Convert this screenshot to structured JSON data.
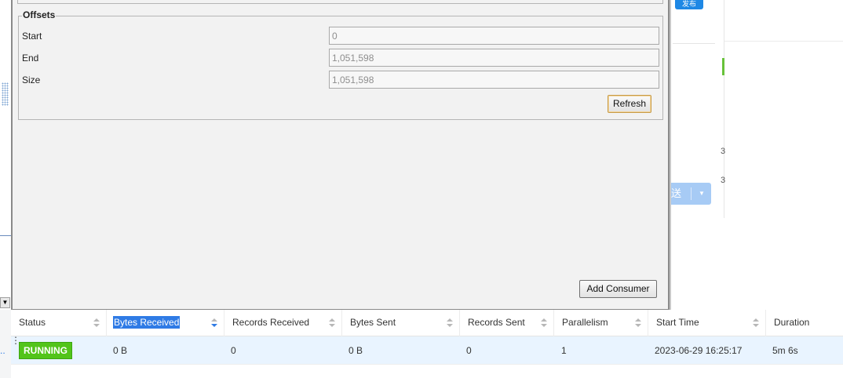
{
  "dialog": {
    "offsets_legend": "Offsets",
    "rows": [
      {
        "label": "Start",
        "value": "0"
      },
      {
        "label": "End",
        "value": "1,051,598"
      },
      {
        "label": "Size",
        "value": "1,051,598"
      }
    ],
    "refresh_label": "Refresh",
    "add_consumer_label": "Add Consumer"
  },
  "background": {
    "top_button_label": "发布",
    "send_button_label": "送",
    "digits": [
      "3",
      "3"
    ]
  },
  "table": {
    "columns": [
      "Status",
      "Bytes Received",
      "Records Received",
      "Bytes Sent",
      "Records Sent",
      "Parallelism",
      "Start Time",
      "Duration"
    ],
    "row": {
      "status": "RUNNING",
      "bytes_received": "0 B",
      "records_received": "0",
      "bytes_sent": "0 B",
      "records_sent": "0",
      "parallelism": "1",
      "start_time": "2023-06-29 16:25:17",
      "duration": "5m 6s"
    }
  },
  "colors": {
    "status_running": "#52c41a",
    "accent": "#2f7be5"
  }
}
